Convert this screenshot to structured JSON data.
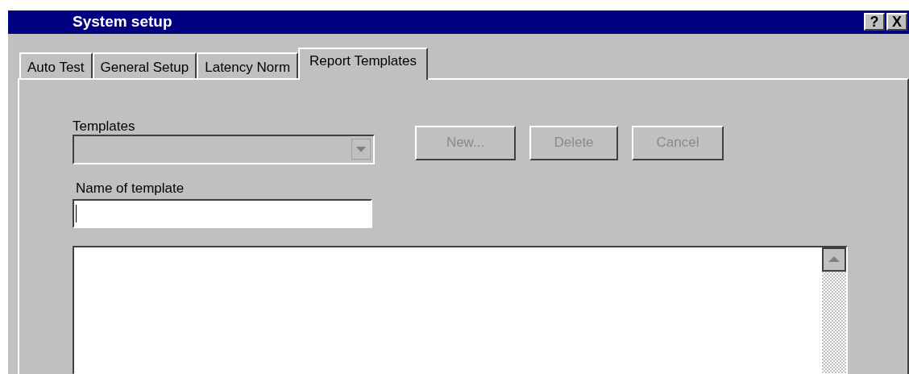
{
  "window": {
    "title": "System setup",
    "help_button": "?",
    "close_button": "X"
  },
  "tabs": [
    {
      "label": "Auto Test",
      "selected": false
    },
    {
      "label": "General Setup",
      "selected": false
    },
    {
      "label": "Latency Norm",
      "selected": false
    },
    {
      "label": "Report Templates",
      "selected": true
    }
  ],
  "templates": {
    "label": "Templates",
    "disabled": true
  },
  "buttons": [
    {
      "label": "New...",
      "disabled": true
    },
    {
      "label": "Delete",
      "disabled": true
    },
    {
      "label": "Cancel",
      "disabled": true
    }
  ],
  "name_field": {
    "label": "Name of template"
  }
}
